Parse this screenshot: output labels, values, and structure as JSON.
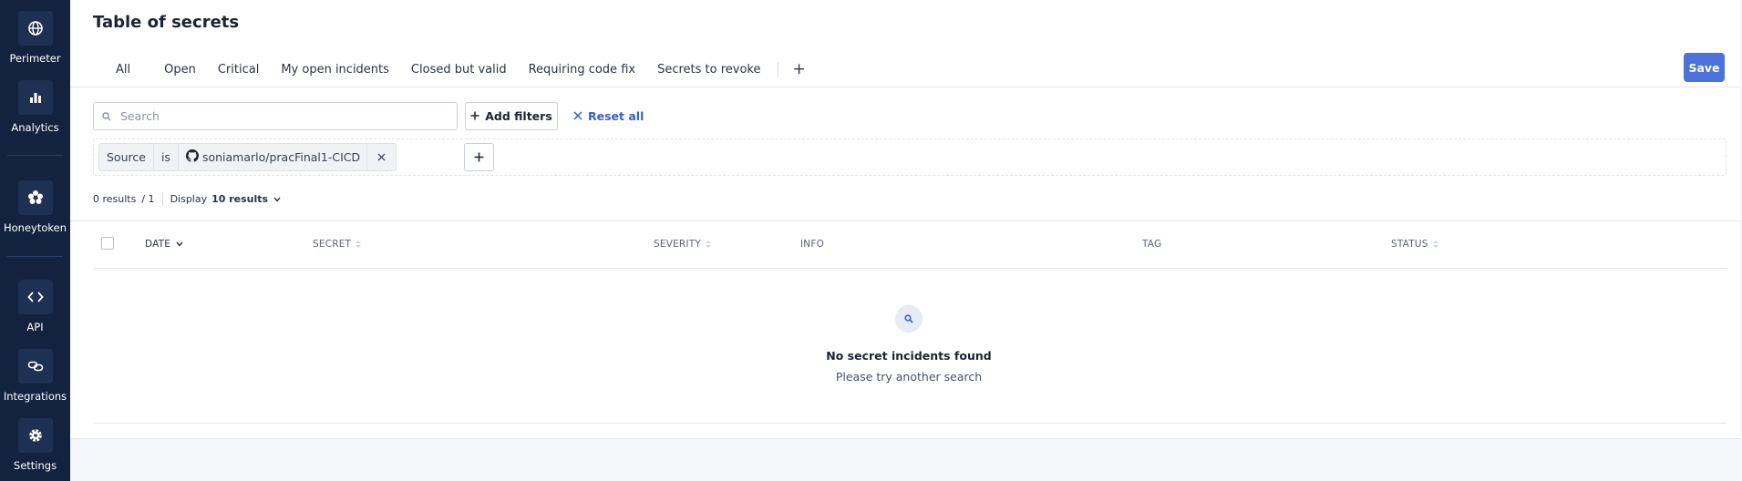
{
  "sidebar": {
    "items": [
      {
        "label": "Perimeter",
        "icon": "globe-icon"
      },
      {
        "label": "Analytics",
        "icon": "bar-chart-icon"
      },
      {
        "label": "Honeytoken",
        "icon": "honeytoken-icon"
      },
      {
        "label": "API",
        "icon": "code-icon"
      },
      {
        "label": "Integrations",
        "icon": "integrations-icon"
      },
      {
        "label": "Settings",
        "icon": "gear-icon"
      }
    ]
  },
  "page": {
    "title": "Table of secrets"
  },
  "tabs": {
    "items": [
      "All",
      "Open",
      "Critical",
      "My open incidents",
      "Closed but valid",
      "Requiring code fix",
      "Secrets to revoke"
    ],
    "add_label": "+"
  },
  "toolbar": {
    "save_label": "Save",
    "search_placeholder": "Search",
    "add_filters_label": "Add filters",
    "reset_all_label": "Reset all"
  },
  "filter": {
    "field": "Source",
    "operator": "is",
    "value": "soniamarlo/pracFinal1-CICD"
  },
  "results": {
    "count_text": "0 results",
    "page_text": "/ 1",
    "display_label": "Display",
    "display_value": "10 results"
  },
  "table": {
    "columns": [
      "DATE",
      "SECRET",
      "SEVERITY",
      "INFO",
      "TAG",
      "STATUS"
    ]
  },
  "empty_state": {
    "title": "No secret incidents found",
    "subtitle": "Please try another search"
  },
  "colors": {
    "sidebar_bg": "#13233f",
    "accent": "#4a72d9",
    "link": "#3461c6"
  }
}
